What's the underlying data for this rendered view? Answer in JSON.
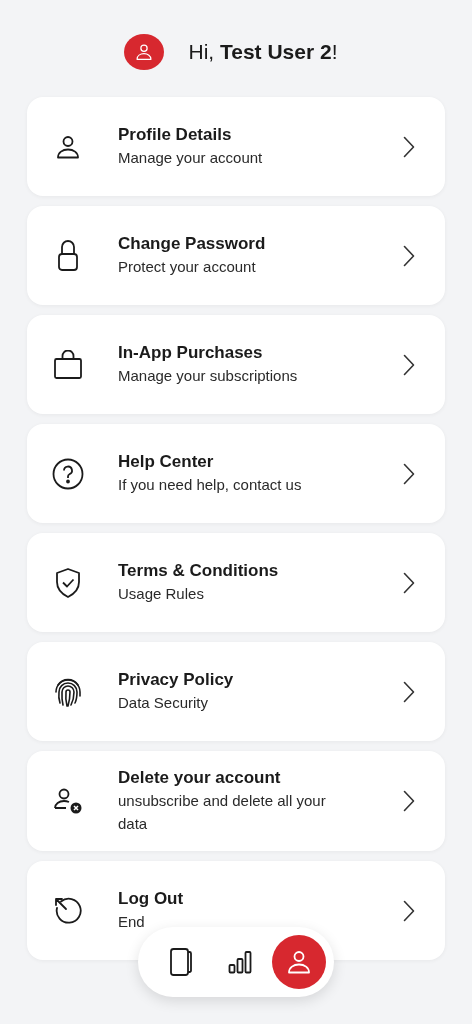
{
  "header": {
    "greeting": "Hi, **Test User 2**!"
  },
  "menu": [
    {
      "kind": "profile",
      "title": "Profile Details",
      "subtitle": "Manage your account"
    },
    {
      "kind": "lock",
      "title": "Change Password",
      "subtitle": "Protect your account"
    },
    {
      "kind": "bag",
      "title": "In-App Purchases",
      "subtitle": "Manage your subscriptions"
    },
    {
      "kind": "help",
      "title": "Help Center",
      "subtitle": "If you need help, contact us"
    },
    {
      "kind": "shield",
      "title": "Terms & Conditions",
      "subtitle": "Usage Rules"
    },
    {
      "kind": "fingerprint",
      "title": "Privacy Policy",
      "subtitle": "Data Security"
    },
    {
      "kind": "delete",
      "title": "Delete your account",
      "subtitle": "unsubscribe and delete all your data"
    },
    {
      "kind": "logout",
      "title": "Log Out",
      "subtitle": "End"
    }
  ],
  "nav": [
    {
      "kind": "document",
      "selected": false
    },
    {
      "kind": "stats",
      "selected": false
    },
    {
      "kind": "profile",
      "selected": true
    }
  ]
}
